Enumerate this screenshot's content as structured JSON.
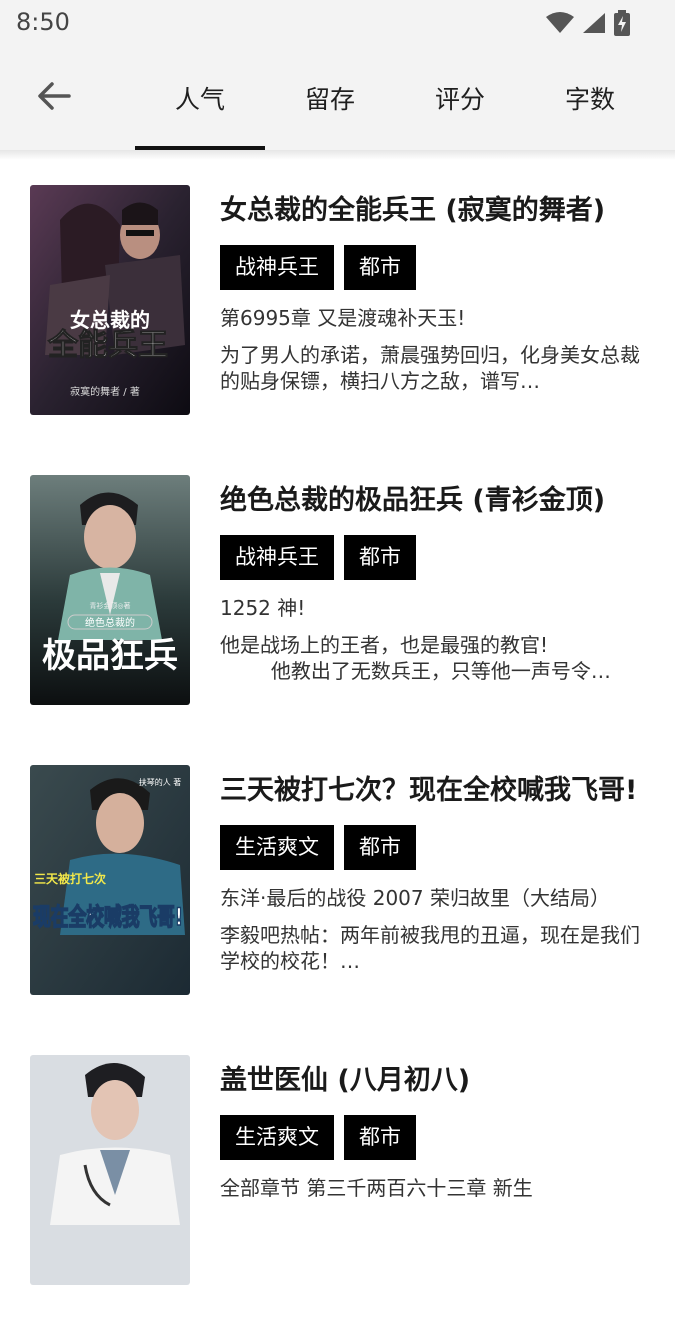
{
  "status_bar": {
    "time": "8:50",
    "icons": [
      "wifi-icon",
      "signal-icon",
      "battery-charging-icon"
    ]
  },
  "header": {
    "back_icon": "arrow-left-icon",
    "tabs": [
      {
        "label": "人气",
        "active": true
      },
      {
        "label": "留存",
        "active": false
      },
      {
        "label": "评分",
        "active": false
      },
      {
        "label": "字数",
        "active": false
      }
    ]
  },
  "books": [
    {
      "title": "女总裁的全能兵王 (寂寞的舞者)",
      "tags": [
        "战神兵王",
        "都市"
      ],
      "latest": "第6995章 又是渡魂补天玉!",
      "desc": "为了男人的承诺，萧晨强势回归，化身美女总裁的贴身保镖，横扫八方之敌，谱写…",
      "cover": {
        "title_top": "女总裁的",
        "title_main": "全能兵王",
        "author": "寂寞的舞者 / 著",
        "palette": "dark-purple"
      }
    },
    {
      "title": "绝色总裁的极品狂兵 (青衫金顶)",
      "tags": [
        "战神兵王",
        "都市"
      ],
      "latest": "1252 神!",
      "desc": "他是战场上的王者，也是最强的教官!\n        他教出了无数兵王，只等他一声号令…",
      "cover": {
        "title_top": "绝色总裁的",
        "title_main": "极品狂兵",
        "author": "青衫金顶◎著",
        "palette": "dark-teal"
      }
    },
    {
      "title": "三天被打七次？现在全校喊我飞哥!",
      "tags": [
        "生活爽文",
        "都市"
      ],
      "latest": "东洋·最后的战役 2007 荣归故里（大结局）",
      "desc": "李毅吧热帖：两年前被我甩的丑逼，现在是我们学校的校花！…",
      "cover": {
        "title_top": "三天被打七次",
        "title_main": "现在全校喊我飞哥!",
        "author": "扶琴的人 著",
        "palette": "blue"
      }
    },
    {
      "title": "盖世医仙 (八月初八)",
      "tags": [
        "生活爽文",
        "都市"
      ],
      "latest": "全部章节 第三千两百六十三章 新生",
      "desc": "",
      "cover": {
        "title_top": "",
        "title_main": "",
        "author": "",
        "palette": "light"
      }
    }
  ]
}
